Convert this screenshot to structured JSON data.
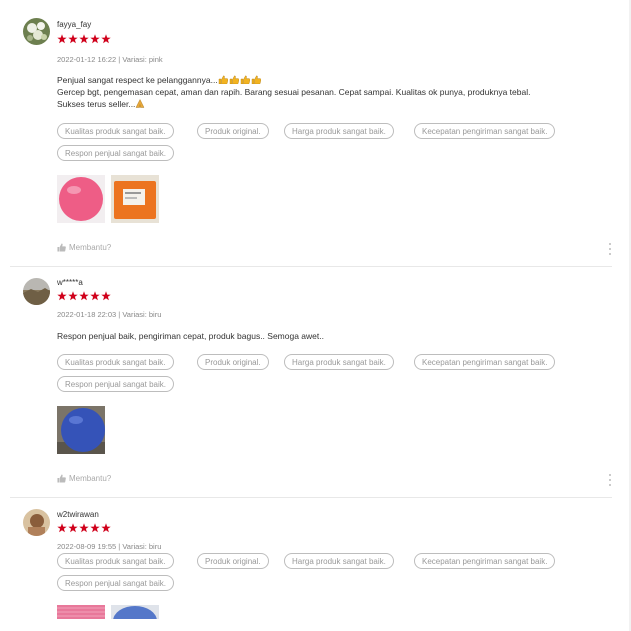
{
  "reviews": [
    {
      "username": "fayya_fay",
      "rating": 5,
      "date_variant": "2022-01-12 16:22 | Variasi: pink",
      "comment_lines": [
        "Penjual sangat respect ke pelanggannya...",
        "Gercep bgt, pengemasan cepat, aman dan rapih. Barang sesuai pesanan. Cepat sampai. Kualitas ok punya, produknya tebal.",
        "Sukses terus seller..."
      ],
      "tags": [
        "Kualitas produk sangat baik.",
        "Produk original.",
        "Harga produk sangat baik.",
        "Kecepatan pengiriman sangat baik.",
        "Respon penjual sangat baik."
      ],
      "photos": [
        "pink-ball-photo",
        "orange-package-photo"
      ],
      "helpful_label": "Membantu?"
    },
    {
      "username": "w*****a",
      "rating": 5,
      "date_variant": "2022-01-18 22:03 | Variasi: biru",
      "comment_lines": [
        "Respon penjual baik, pengiriman cepat, produk bagus.. Semoga awet.."
      ],
      "tags": [
        "Kualitas produk sangat baik.",
        "Produk original.",
        "Harga produk sangat baik.",
        "Kecepatan pengiriman sangat baik.",
        "Respon penjual sangat baik."
      ],
      "photos": [
        "blue-ball-photo"
      ],
      "helpful_label": "Membantu?"
    },
    {
      "username": "w2twirawan",
      "rating": 5,
      "date_variant": "2022-08-09 19:55 | Variasi: biru",
      "comment_lines": [],
      "tags": [
        "Kualitas produk sangat baik.",
        "Produk original.",
        "Harga produk sangat baik.",
        "Kecepatan pengiriman sangat baik.",
        "Respon penjual sangat baik."
      ],
      "photos": [
        "pink-ball-photo",
        "blue-ball-photo"
      ]
    }
  ],
  "colors": {
    "star": "#d0011b",
    "tag_border": "#bdbdbd",
    "tag_text": "#999999",
    "muted": "#888888"
  },
  "icons": {
    "star": "star-icon",
    "helpful": "thumbs-up-icon",
    "more": "more-vertical-icon",
    "emoji_thumb": "thumbs-up-emoji",
    "emoji_pray": "folded-hands-emoji"
  }
}
